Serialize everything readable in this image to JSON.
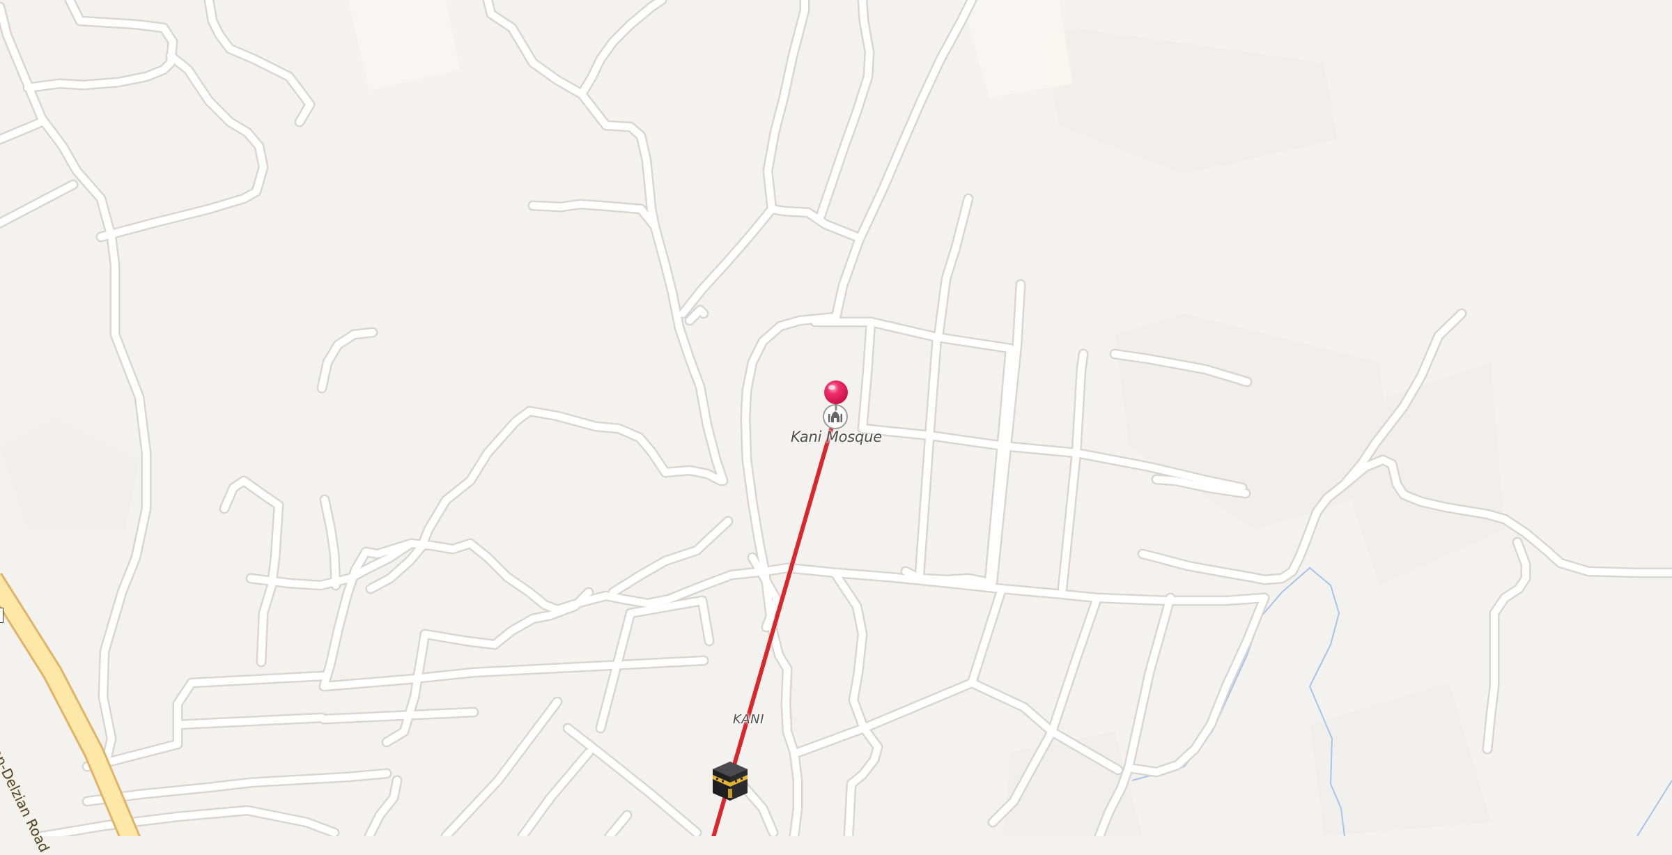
{
  "map": {
    "poi_label": "Kani Mosque",
    "place_label": "KANI",
    "road_label": "Soran-Delzian Road"
  },
  "icons": {
    "mosque": "mosque-icon",
    "pin": "location-pin-icon",
    "destination": "kaaba-icon"
  },
  "colors": {
    "background": "#f4f2ef",
    "road_fill": "#ffffff",
    "road_casing": "#d9d6d2",
    "primary_road": "#fde8a8",
    "primary_casing": "#e0b367",
    "qibla_line": "#d9272e",
    "pin": "#e8195c",
    "river": "#a6c4e8"
  }
}
